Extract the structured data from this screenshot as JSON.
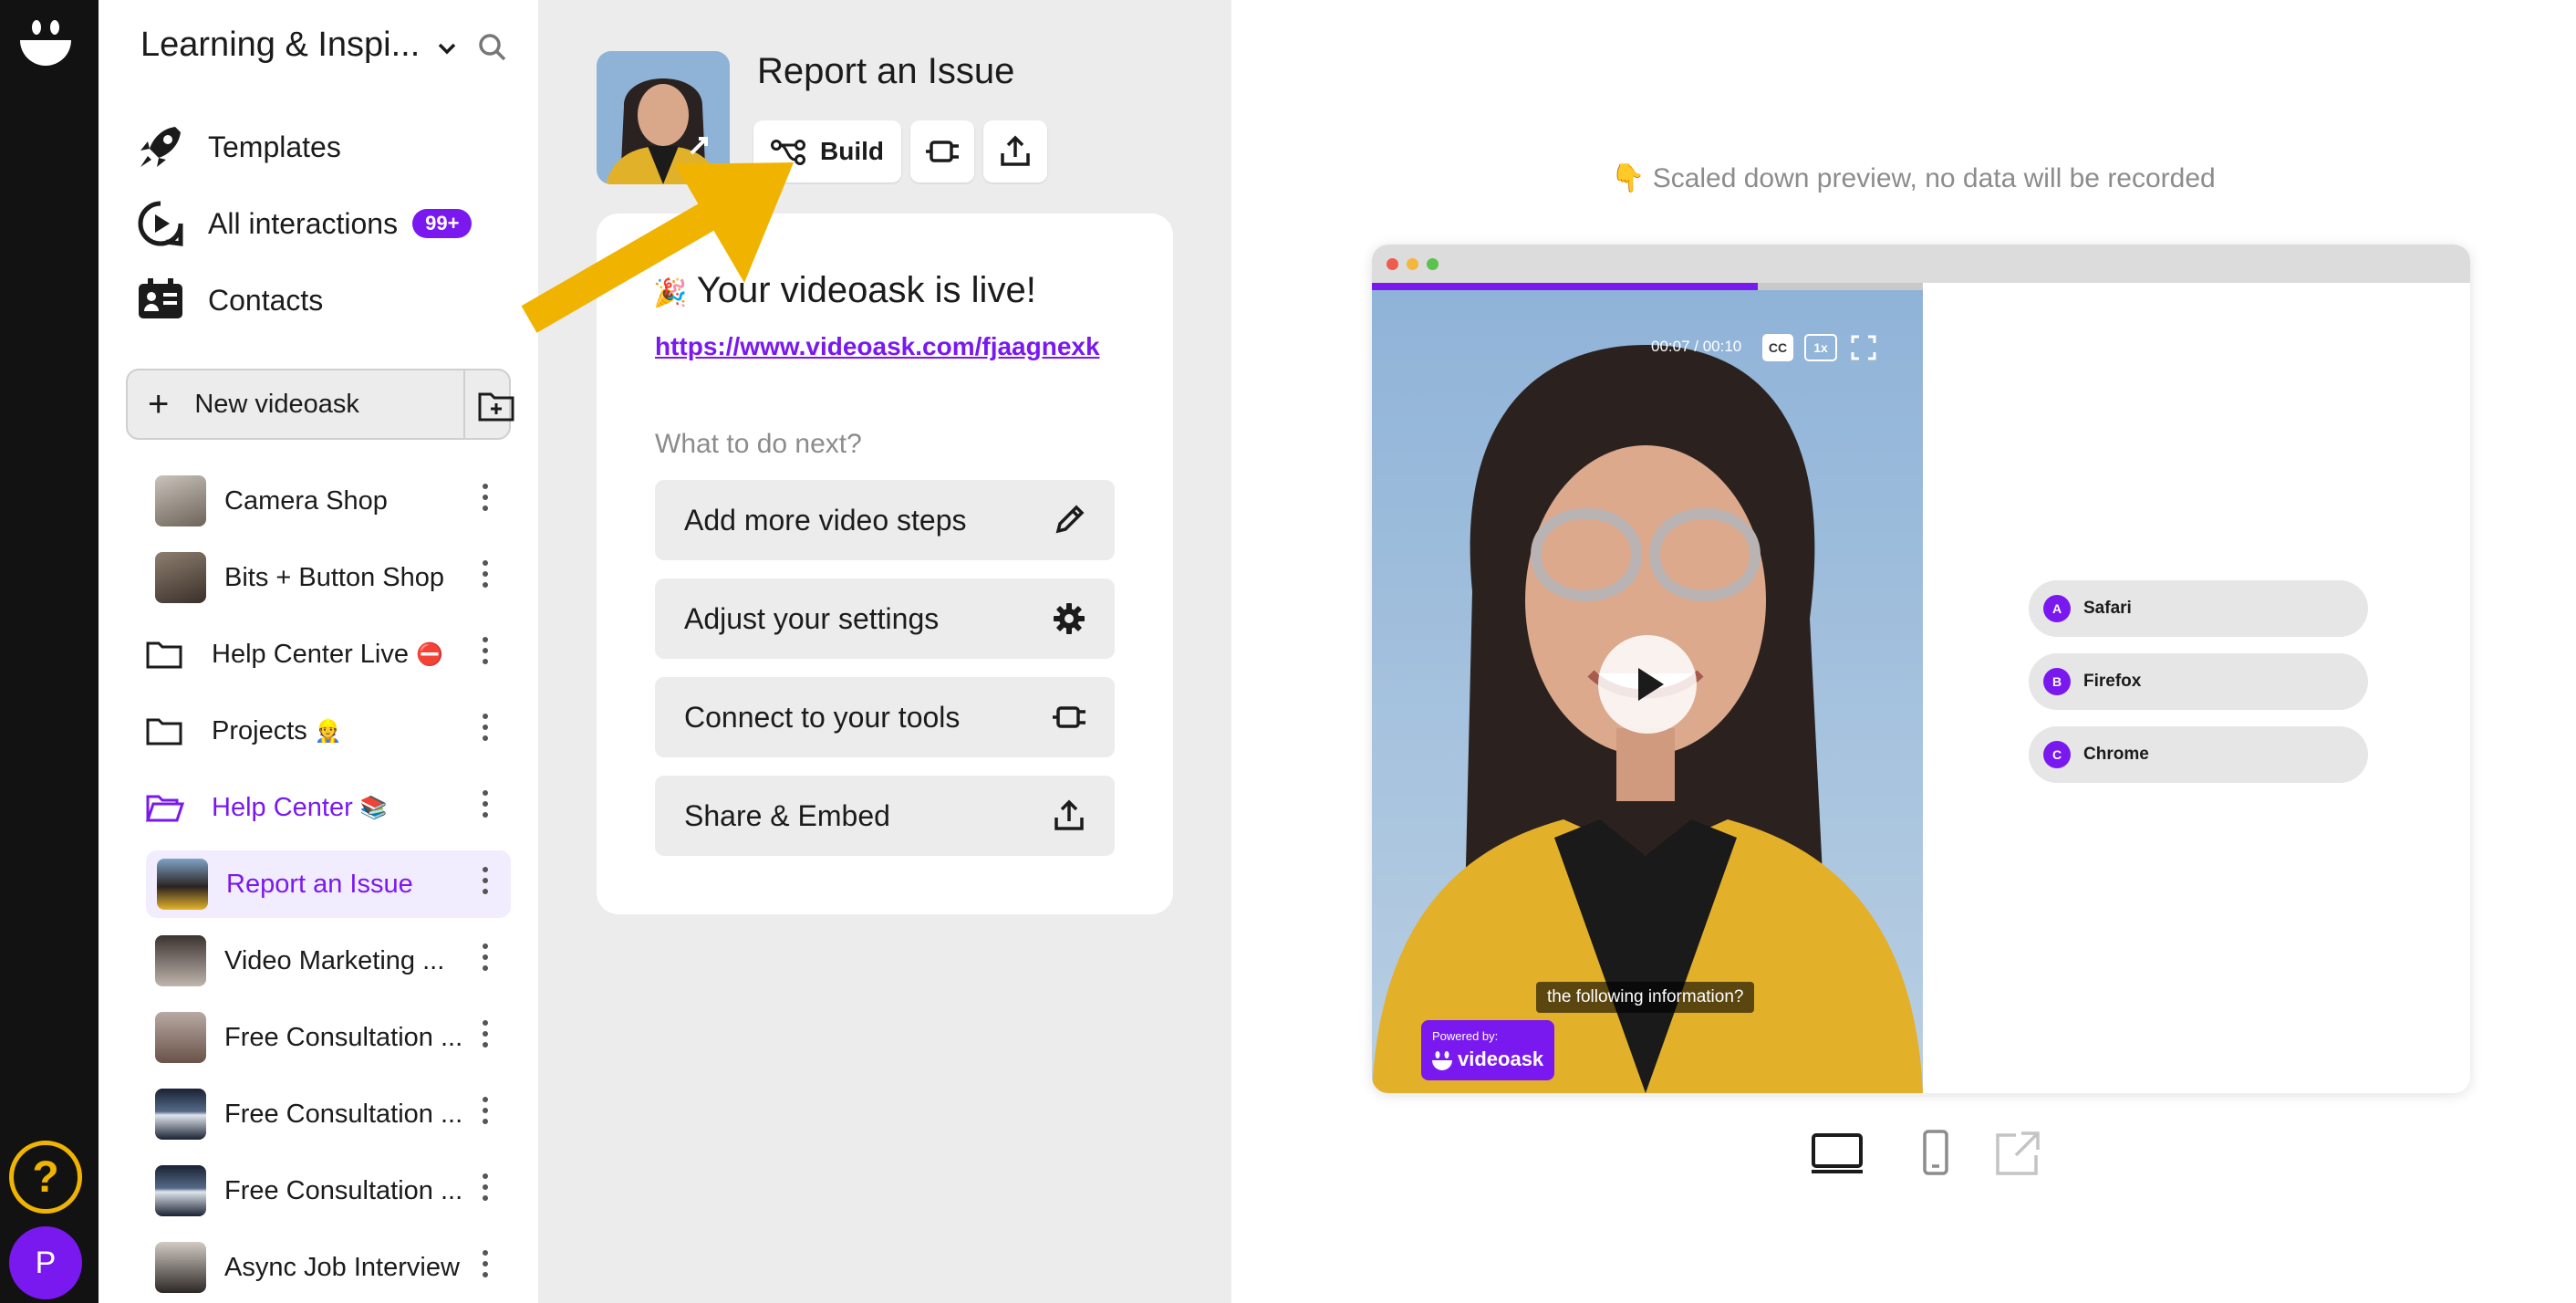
{
  "workspace": {
    "title": "Learning & Inspi..."
  },
  "nav": [
    {
      "label": "Templates",
      "icon": "rocket-icon"
    },
    {
      "label": "All interactions",
      "icon": "play-bubble-icon",
      "badge": "99+"
    },
    {
      "label": "Contacts",
      "icon": "contacts-icon"
    }
  ],
  "new_button": {
    "label": "New videoask"
  },
  "list": [
    {
      "label": "Camera Shop",
      "type": "thumb",
      "emoji": ""
    },
    {
      "label": "Bits + Button Shop",
      "type": "thumb",
      "emoji": ""
    },
    {
      "label": "Help Center Live",
      "type": "folder",
      "emoji": "⛔"
    },
    {
      "label": "Projects",
      "type": "folder",
      "emoji": "👷"
    },
    {
      "label": "Help Center",
      "type": "folder-open",
      "emoji": "📚"
    },
    {
      "label": "Report an Issue",
      "type": "thumb",
      "emoji": ""
    },
    {
      "label": "Video Marketing ...",
      "type": "thumb",
      "emoji": ""
    },
    {
      "label": "Free Consultation ...",
      "type": "thumb",
      "emoji": ""
    },
    {
      "label": "Free Consultation ...",
      "type": "thumb",
      "emoji": ""
    },
    {
      "label": "Free Consultation ...",
      "type": "thumb",
      "emoji": ""
    },
    {
      "label": "Async Job Interview",
      "type": "thumb",
      "emoji": ""
    }
  ],
  "rail": {
    "help_label": "?",
    "avatar_initial": "P"
  },
  "editor": {
    "title": "Report an Issue",
    "build_label": "Build",
    "live_emoji": "🎉",
    "live_title": "Your videoask is live!",
    "live_link": "https://www.videoask.com/fjaagnexk",
    "next_label": "What to do next?",
    "actions": [
      {
        "label": "Add more video steps",
        "icon": "pencil-icon"
      },
      {
        "label": "Adjust your settings",
        "icon": "gear-icon"
      },
      {
        "label": "Connect to your tools",
        "icon": "plug-icon"
      },
      {
        "label": "Share & Embed",
        "icon": "share-icon"
      }
    ]
  },
  "preview": {
    "note": "👇 Scaled down preview, no data will be recorded",
    "time": "00:07 / 00:10",
    "cc_label": "CC",
    "speed_label": "1x",
    "progress": 0.7,
    "caption": "the following information?",
    "powered_by": "Powered by:",
    "brand": "videoask",
    "choices": [
      {
        "letter": "A",
        "label": "Safari"
      },
      {
        "letter": "B",
        "label": "Firefox"
      },
      {
        "letter": "C",
        "label": "Chrome"
      }
    ]
  },
  "colors": {
    "accent": "#7a19ef",
    "arrow": "#f0b400",
    "rail": "#121212",
    "panel": "#ececec"
  }
}
